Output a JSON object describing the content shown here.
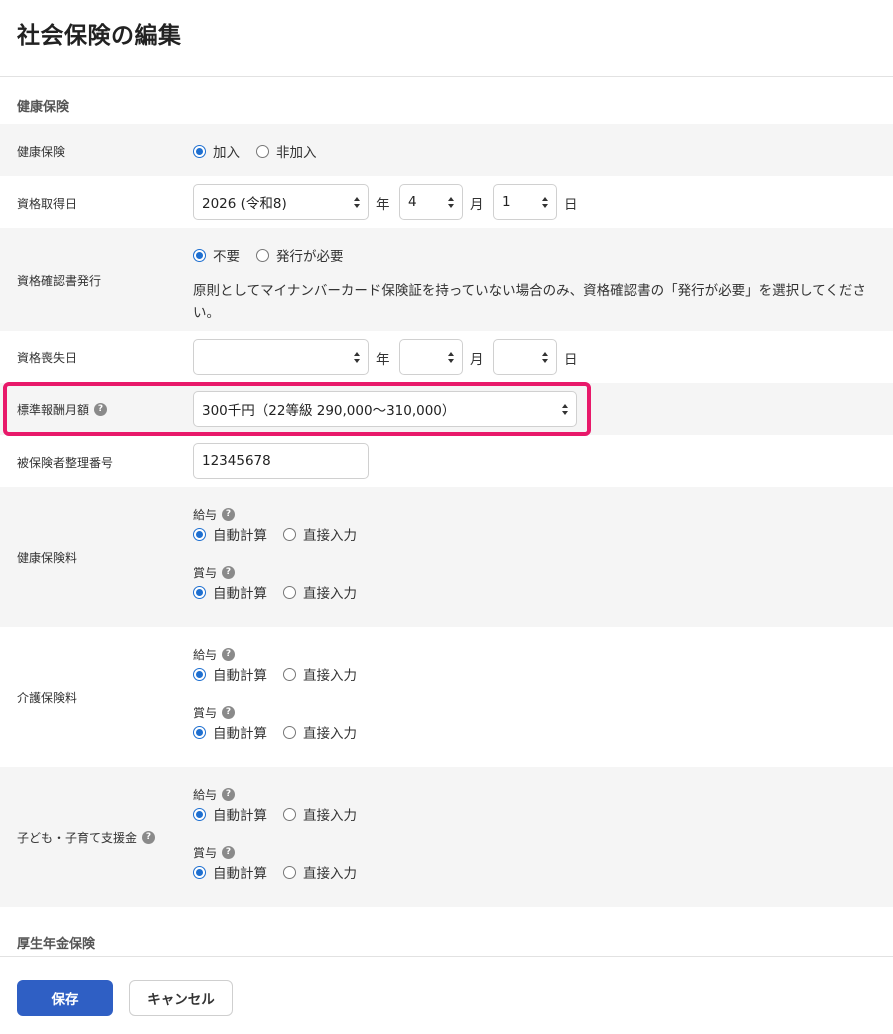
{
  "page_title": "社会保険の編集",
  "health_section": {
    "title": "健康保険",
    "enrollment": {
      "label": "健康保険",
      "options": [
        "加入",
        "非加入"
      ],
      "selected": "加入"
    },
    "acquisition_date": {
      "label": "資格取得日",
      "year": "2026 (令和8)",
      "year_unit": "年",
      "month": "4",
      "month_unit": "月",
      "day": "1",
      "day_unit": "日"
    },
    "certificate": {
      "label": "資格確認書発行",
      "options": [
        "不要",
        "発行が必要"
      ],
      "selected": "不要",
      "note": "原則としてマイナンバーカード保険証を持っていない場合のみ、資格確認書の「発行が必要」を選択してください。"
    },
    "loss_date": {
      "label": "資格喪失日",
      "year": "",
      "year_unit": "年",
      "month": "",
      "month_unit": "月",
      "day": "",
      "day_unit": "日"
    },
    "standard_remuneration": {
      "label": "標準報酬月額",
      "value": "300千円（22等級 290,000〜310,000）"
    },
    "insured_number": {
      "label": "被保険者整理番号",
      "value": "12345678"
    },
    "premium_groups": [
      {
        "label": "健康保険料",
        "salary_label": "給与",
        "bonus_label": "賞与",
        "options": [
          "自動計算",
          "直接入力"
        ],
        "salary_selected": "自動計算",
        "bonus_selected": "自動計算"
      },
      {
        "label": "介護保険料",
        "salary_label": "給与",
        "bonus_label": "賞与",
        "options": [
          "自動計算",
          "直接入力"
        ],
        "salary_selected": "自動計算",
        "bonus_selected": "自動計算"
      },
      {
        "label": "子ども・子育て支援金",
        "salary_label": "給与",
        "bonus_label": "賞与",
        "options": [
          "自動計算",
          "直接入力"
        ],
        "salary_selected": "自動計算",
        "bonus_selected": "自動計算"
      }
    ]
  },
  "pension_section": {
    "title": "厚生年金保険"
  },
  "help_icon_glyph": "?",
  "footer": {
    "save_label": "保存",
    "cancel_label": "キャンセル"
  },
  "colors": {
    "accent": "#2f5fc4",
    "radio_selected": "#1e6fd0",
    "highlight": "#e8196a",
    "row_shade": "#f5f5f5"
  }
}
